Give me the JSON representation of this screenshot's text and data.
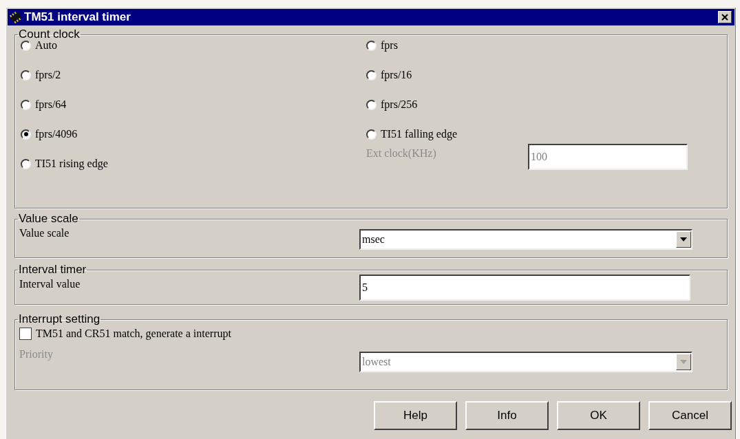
{
  "window": {
    "title": "TM51 interval timer"
  },
  "count_clock": {
    "title": "Count clock",
    "options": [
      {
        "label": "Auto",
        "selected": false
      },
      {
        "label": "fprs",
        "selected": false
      },
      {
        "label": "fprs/2",
        "selected": false
      },
      {
        "label": "fprs/16",
        "selected": false
      },
      {
        "label": "fprs/64",
        "selected": false
      },
      {
        "label": "fprs/256",
        "selected": false
      },
      {
        "label": "fprs/4096",
        "selected": true
      },
      {
        "label": "TI51 falling edge",
        "selected": false
      },
      {
        "label": "TI51 rising edge",
        "selected": false
      }
    ],
    "ext_clock": {
      "label": "Ext clock(KHz)",
      "value": "100",
      "disabled": true
    }
  },
  "value_scale": {
    "title": "Value scale",
    "label": "Value scale",
    "value": "msec"
  },
  "interval_timer": {
    "title": "Interval timer",
    "label": "Interval value",
    "value": "5"
  },
  "interrupt_setting": {
    "title": "Interrupt setting",
    "checkbox": {
      "label": "TM51 and CR51 match, generate a interrupt",
      "checked": false
    },
    "priority": {
      "label": "Priority",
      "value": "lowest",
      "disabled": true
    }
  },
  "buttons": [
    "Help",
    "Info",
    "OK",
    "Cancel"
  ]
}
